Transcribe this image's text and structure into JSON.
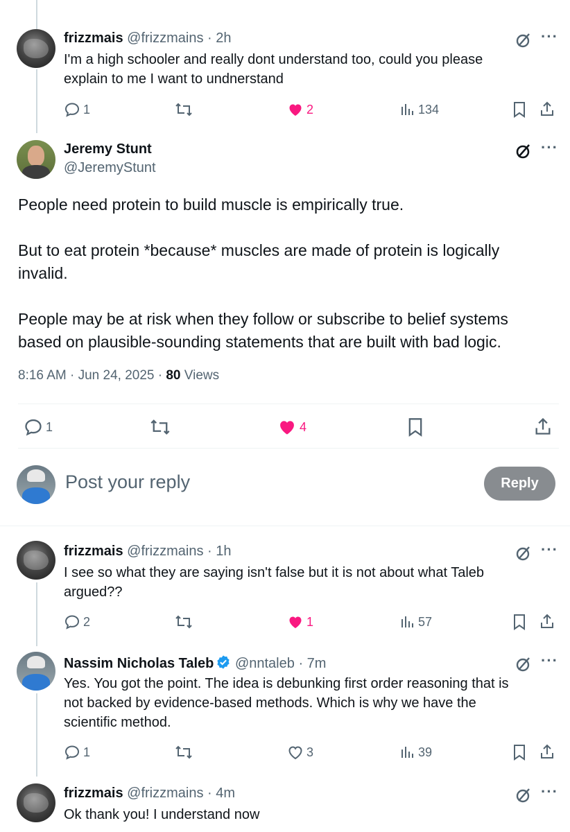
{
  "posts": [
    {
      "name": "frizzmais",
      "handle": "@frizzmains",
      "time": "· 2h",
      "text_lines": [
        "I'm a high schooler and really dont understand too, could you please",
        "explain to me I want to undnerstand"
      ],
      "replies": "1",
      "likes": "2",
      "views": "134",
      "liked": true
    },
    {
      "name": "frizzmais",
      "handle": "@frizzmains",
      "time": "· 1h",
      "text_lines": [
        "I see so what they are saying isn't false but it is not about what Taleb",
        "argued??"
      ],
      "replies": "2",
      "likes": "1",
      "views": "57",
      "liked": true
    },
    {
      "name": "Nassim Nicholas Taleb",
      "handle": "@nntaleb",
      "time": "· 7m",
      "text_lines": [
        "Yes. You got the point. The idea is debunking first order reasoning that is",
        "not backed by evidence-based methods. Which is why we have the",
        "scientific method."
      ],
      "replies": "1",
      "likes": "3",
      "views": "39",
      "liked": false
    },
    {
      "name": "frizzmais",
      "handle": "@frizzmains",
      "time": "· 4m",
      "text_lines": [
        "Ok thank you! I understand now"
      ]
    }
  ],
  "main_post": {
    "name": "Jeremy Stunt",
    "handle": "@JeremyStunt",
    "paragraphs": [
      [
        "People need protein to build muscle is empirically true."
      ],
      [
        "But to eat protein *because* muscles are made of protein is logically",
        "invalid."
      ],
      [
        "People may be at risk when they follow or subscribe to belief systems",
        "based on plausible-sounding statements that are built with bad logic."
      ]
    ],
    "timestamp": "8:16 AM · Jun 24, 2025 · ",
    "views_count": "80",
    "views_label": " Views",
    "replies": "1",
    "likes": "4"
  },
  "composer": {
    "placeholder": "Post your reply",
    "button_label": "Reply"
  },
  "colors": {
    "like_pink": "#f91880",
    "muted": "#536471",
    "verified_blue": "#1d9bf0"
  },
  "icons": [
    "reply-icon",
    "retweet-icon",
    "heart-icon",
    "views-icon",
    "bookmark-icon",
    "share-icon",
    "grok-icon",
    "more-icon",
    "verified-badge-icon"
  ]
}
